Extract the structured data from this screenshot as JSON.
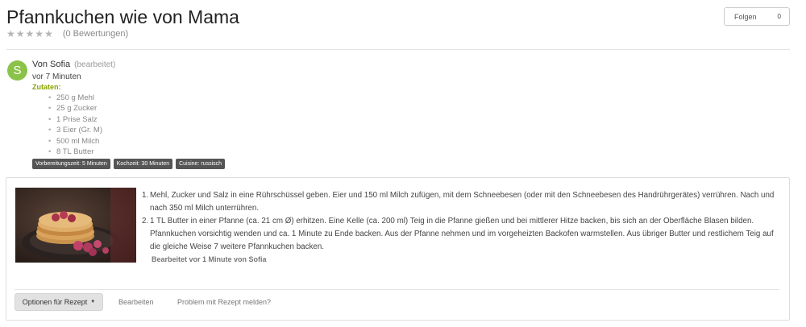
{
  "header": {
    "title": "Pfannkuchen wie von Mama",
    "rating_count": "(0 Bewertungen)",
    "stars": 5,
    "follow_label": "Folgen",
    "follow_count": "0"
  },
  "post": {
    "avatar_letter": "S",
    "author": "Von Sofia",
    "edited": "(bearbeitet)",
    "time": "vor 7 Minuten",
    "ingredients_label": "Zutaten:",
    "ingredients": [
      "250 g Mehl",
      "25 g Zucker",
      "1 Prise Salz",
      "3  Eier (Gr. M)",
      "500 ml Milch",
      "8 TL Butter"
    ],
    "tags": [
      "Vorbereitungszeit: 5 Minuten",
      "Kochzeit: 30 Minuten",
      "Cuisine: russisch"
    ]
  },
  "recipe": {
    "steps": [
      "Mehl, Zucker und Salz in eine Rührschüssel geben. Eier und 150 ml Milch zufügen, mit dem Schneebesen (oder mit den Schneebesen des Handrührgerätes) verrühren. Nach und nach 350 ml Milch unterrühren.",
      "1 TL Butter in einer Pfanne (ca. 21 cm Ø) erhitzen. Eine Kelle (ca. 200 ml) Teig in die Pfanne gießen und bei mittlerer Hitze backen, bis sich an der Oberfläche Blasen bilden. Pfannkuchen vorsichtig wenden und ca. 1 Minute zu Ende backen. Aus der Pfanne nehmen und im vorgeheizten Backofen warmstellen. Aus übriger Butter und restlichem Teig auf die gleiche Weise 7 weitere Pfannkuchen backen."
    ],
    "edited_by": "Bearbeitet vor 1 Minute von Sofia",
    "options_label": "Optionen für Rezept",
    "edit_label": "Bearbeiten",
    "report_label": "Problem mit Rezept melden?"
  },
  "colors": {
    "avatar": "#8bc34a",
    "ingredients_label": "#8aa300",
    "tag_bg": "#555555"
  }
}
